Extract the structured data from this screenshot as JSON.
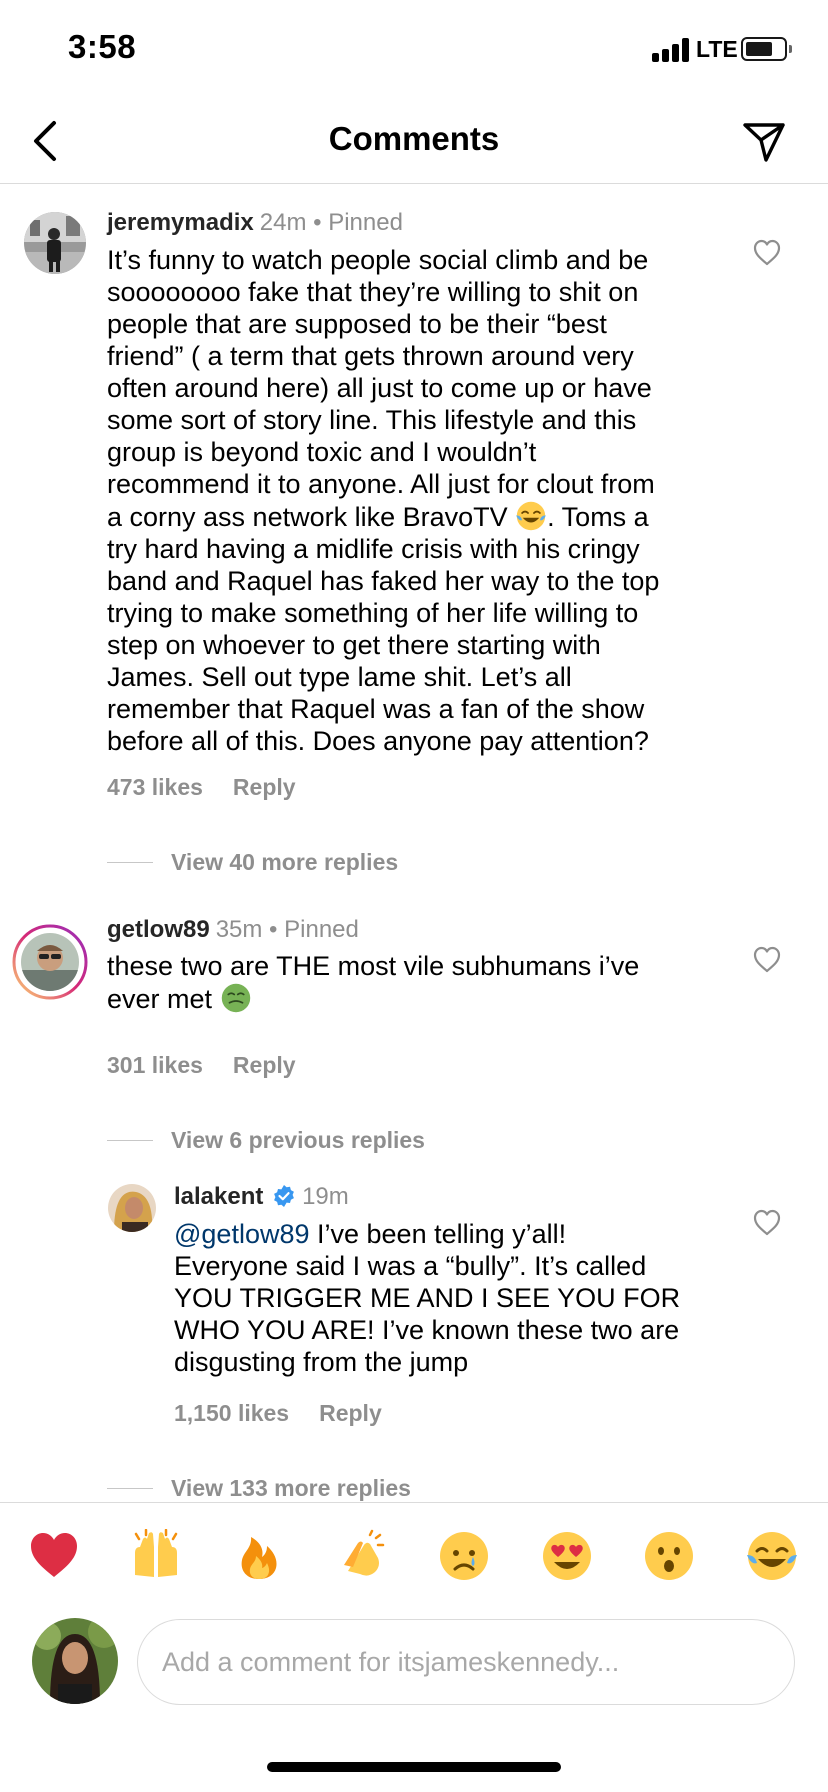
{
  "status_bar": {
    "time": "3:58",
    "network": "LTE"
  },
  "header": {
    "title": "Comments"
  },
  "comments": [
    {
      "username": "jeremymadix",
      "meta": "24m • Pinned",
      "lines": [
        "It’s funny to watch people social climb and be",
        "soooooooo fake that they’re willing to shit on",
        "people that are supposed to be their “best",
        "friend” ( a term that gets thrown around very",
        "often around here) all just to come up or have",
        "some sort of story line. This lifestyle and this",
        "group is beyond toxic and I wouldn’t",
        "recommend it to anyone. All just for clout from",
        "a corny ass network like BravoTV ",
        ". Toms  a",
        "try hard having a midlife crisis with his cringy",
        "band and Raquel has faked her way to the top",
        "trying to make something of her life willing to",
        "step on whoever to get there starting with",
        "James. Sell out type lame shit. Let’s all",
        "remember that Raquel was a fan of the show",
        "before all of this. Does anyone pay attention?"
      ],
      "likes": "473 likes",
      "reply_label": "Reply",
      "view_more": "View 40 more replies"
    },
    {
      "username": "getlow89",
      "meta": "35m • Pinned",
      "lines": [
        "these two are THE most vile subhumans i’ve",
        "ever met "
      ],
      "likes": "301 likes",
      "reply_label": "Reply",
      "view_more": "View 6 previous replies"
    },
    {
      "username": "lalakent",
      "meta": "19m",
      "verified": true,
      "mention": "@getlow89",
      "lines": [
        " I’ve been telling y’all!",
        "Everyone said I was a “bully”. It’s called",
        "YOU TRIGGER ME AND I SEE YOU FOR",
        "WHO YOU ARE! I’ve known these two are",
        "disgusting from the jump"
      ],
      "likes": "1,150 likes",
      "reply_label": "Reply",
      "view_more": "View 133 more replies"
    }
  ],
  "emoji_bar": [
    "red-heart",
    "raising-hands",
    "fire",
    "clapping-hands",
    "crying-face",
    "heart-eyes",
    "surprised-face",
    "tears-of-joy"
  ],
  "input": {
    "placeholder": "Add a comment for itsjameskennedy..."
  },
  "colors": {
    "link": "#00376b",
    "muted": "#8e8e8e",
    "divider": "#dbdbdb",
    "verified": "#3897f0"
  }
}
